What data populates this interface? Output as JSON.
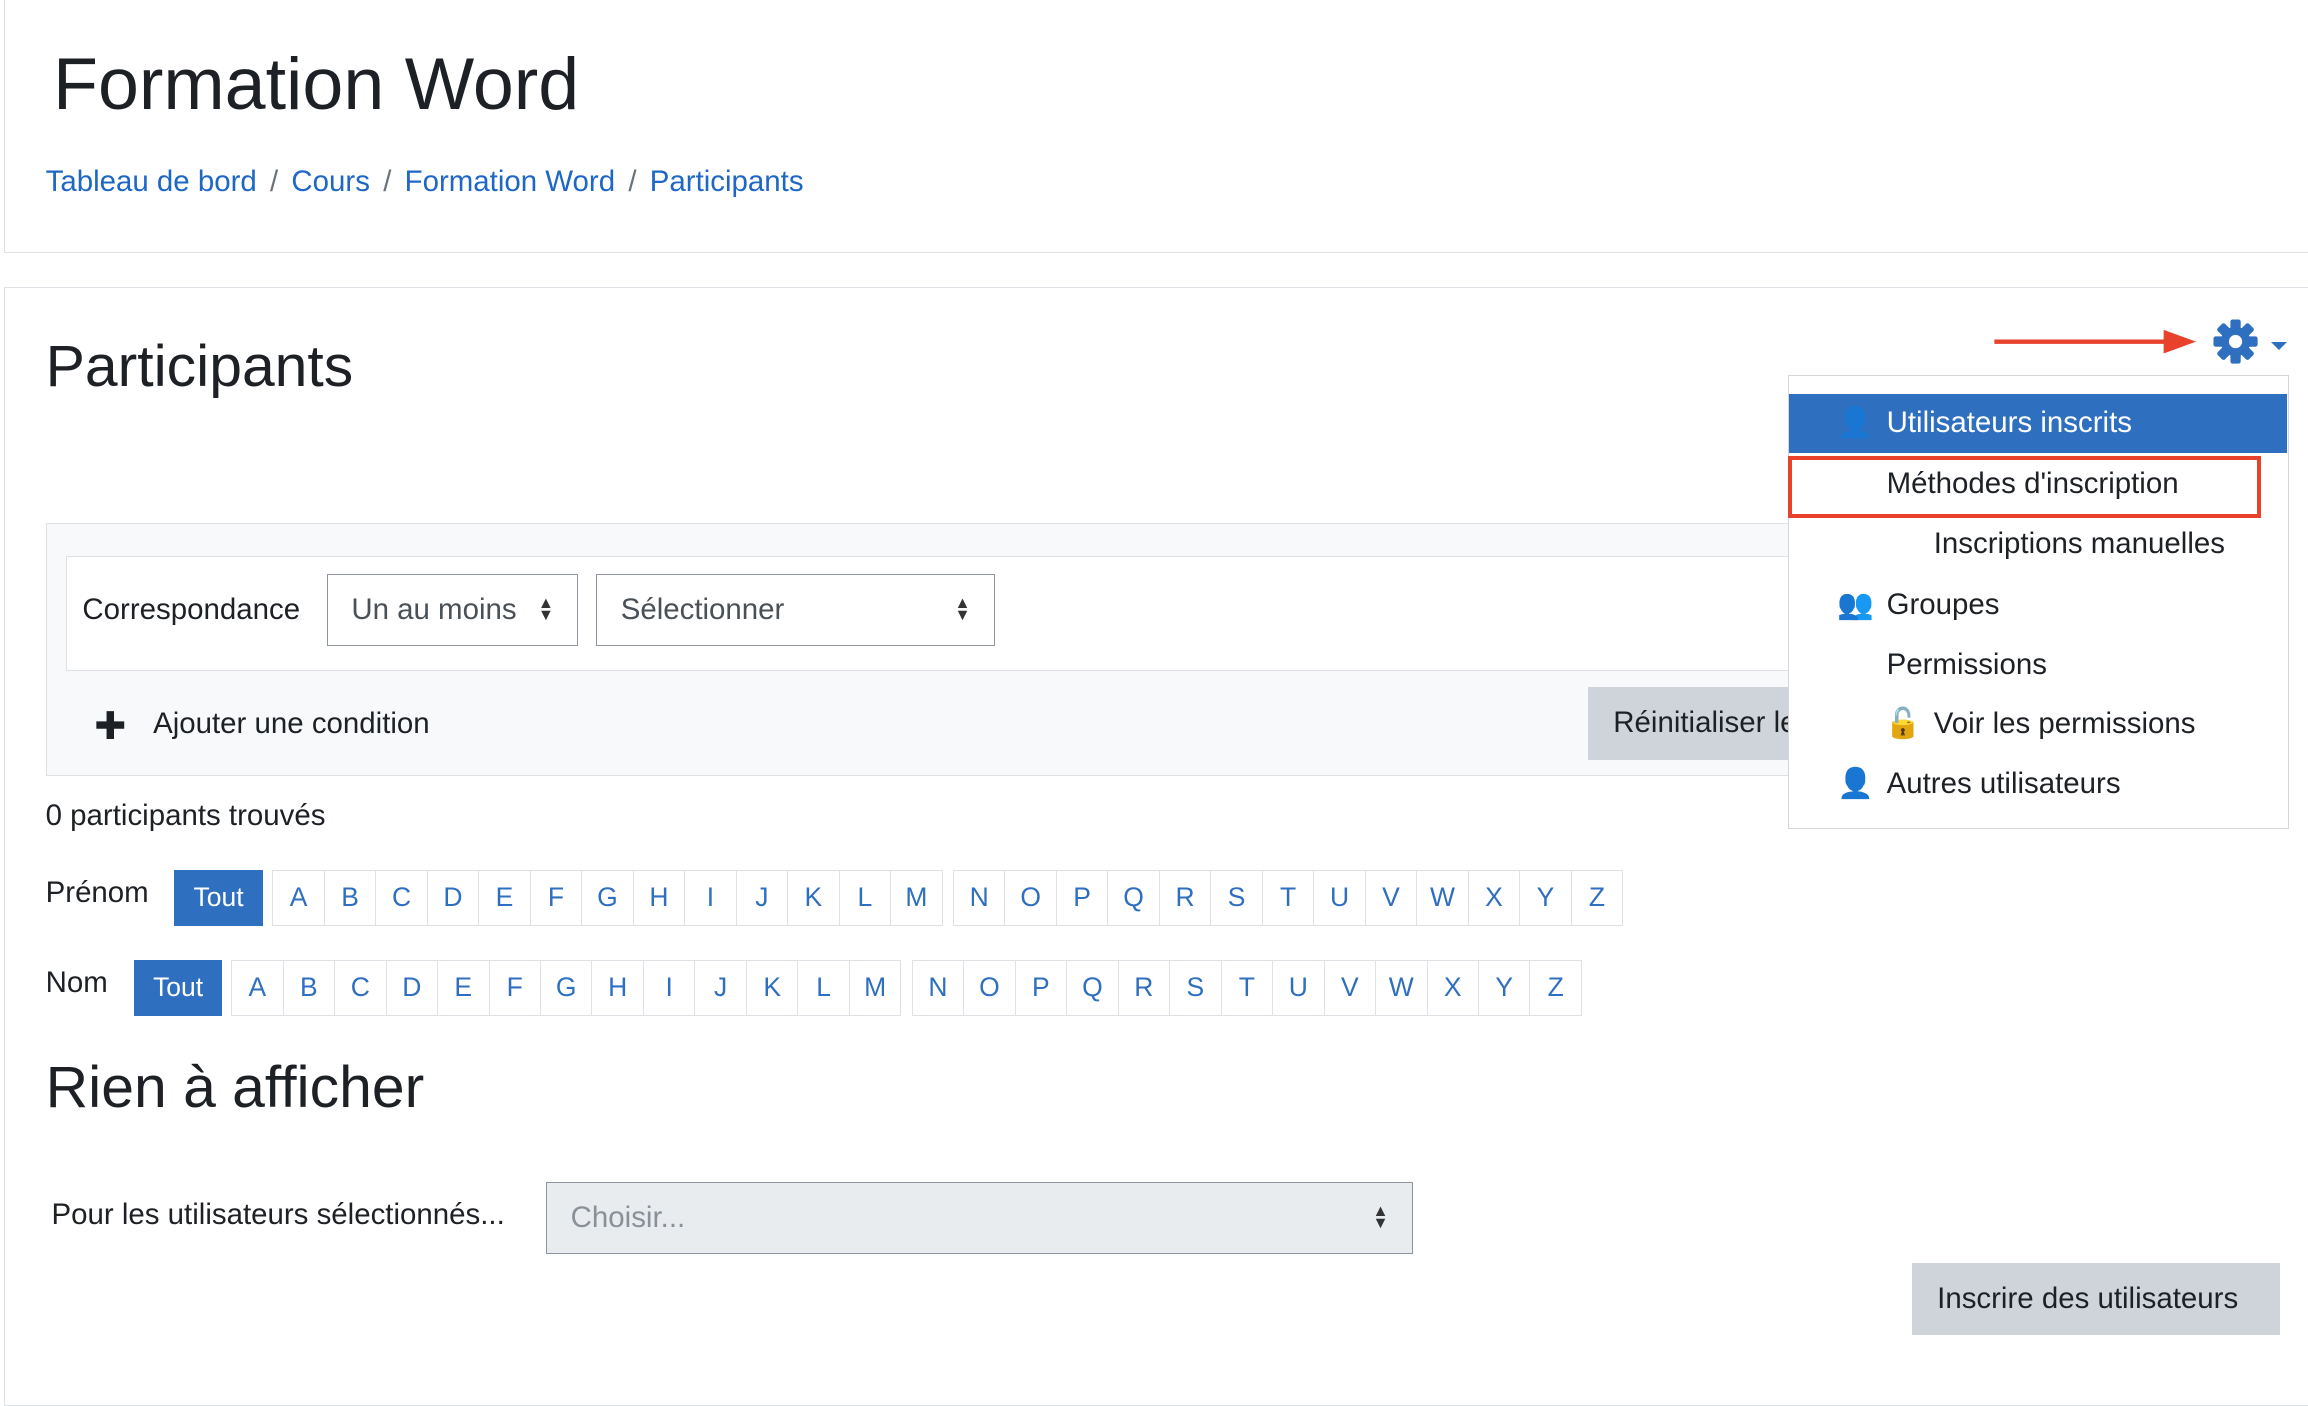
{
  "header": {
    "title": "Formation Word",
    "breadcrumb": [
      "Tableau de bord",
      "Cours",
      "Formation Word",
      "Participants"
    ]
  },
  "main": {
    "title": "Participants",
    "filter": {
      "match_label": "Correspondance",
      "match_value": "Un au moins",
      "select_value": "Sélectionner",
      "add_condition": "Ajouter une condition",
      "reset_label": "Réinitialiser les filtres"
    },
    "count": "0 participants trouvés",
    "firstname": {
      "label": "Prénom",
      "all": "Tout"
    },
    "lastname": {
      "label": "Nom",
      "all": "Tout"
    },
    "letters_1": [
      "A",
      "B",
      "C",
      "D",
      "E",
      "F",
      "G",
      "H",
      "I",
      "J",
      "K",
      "L",
      "M"
    ],
    "letters_2": [
      "N",
      "O",
      "P",
      "Q",
      "R",
      "S",
      "T",
      "U",
      "V",
      "W",
      "X",
      "Y",
      "Z"
    ],
    "empty": "Rien à afficher",
    "bulk_label": "Pour les utilisateurs sélectionnés...",
    "bulk_placeholder": "Choisir...",
    "enrol_button": "Inscrire des utilisateurs"
  },
  "menu": {
    "items": [
      {
        "label": "Utilisateurs inscrits",
        "icon": "user-plus-icon",
        "active": true
      },
      {
        "label": "Méthodes d'inscription",
        "highlighted": true
      },
      {
        "label": "Inscriptions manuelles"
      },
      {
        "label": "Groupes",
        "icon": "users-icon"
      },
      {
        "label": "Permissions"
      },
      {
        "label": "Voir les permissions",
        "icon": "unlock-icon"
      },
      {
        "label": "Autres utilisateurs",
        "icon": "user-plus-icon"
      }
    ]
  },
  "colors": {
    "accent": "#2f6fc0",
    "annotation": "#e8412c"
  }
}
